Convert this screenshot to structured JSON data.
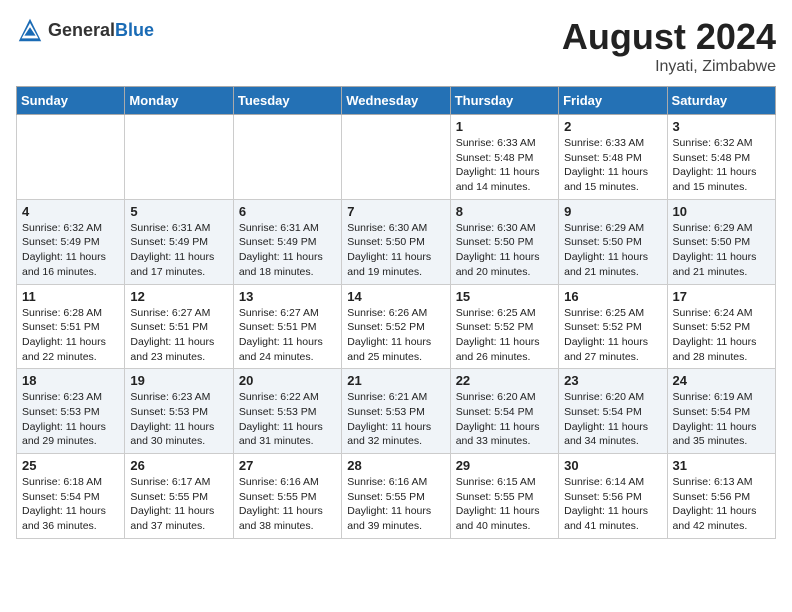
{
  "header": {
    "logo_general": "General",
    "logo_blue": "Blue",
    "month_year": "August 2024",
    "location": "Inyati, Zimbabwe"
  },
  "days_of_week": [
    "Sunday",
    "Monday",
    "Tuesday",
    "Wednesday",
    "Thursday",
    "Friday",
    "Saturday"
  ],
  "weeks": [
    [
      {
        "day": "",
        "info": ""
      },
      {
        "day": "",
        "info": ""
      },
      {
        "day": "",
        "info": ""
      },
      {
        "day": "",
        "info": ""
      },
      {
        "day": "1",
        "info": "Sunrise: 6:33 AM\nSunset: 5:48 PM\nDaylight: 11 hours\nand 14 minutes."
      },
      {
        "day": "2",
        "info": "Sunrise: 6:33 AM\nSunset: 5:48 PM\nDaylight: 11 hours\nand 15 minutes."
      },
      {
        "day": "3",
        "info": "Sunrise: 6:32 AM\nSunset: 5:48 PM\nDaylight: 11 hours\nand 15 minutes."
      }
    ],
    [
      {
        "day": "4",
        "info": "Sunrise: 6:32 AM\nSunset: 5:49 PM\nDaylight: 11 hours\nand 16 minutes."
      },
      {
        "day": "5",
        "info": "Sunrise: 6:31 AM\nSunset: 5:49 PM\nDaylight: 11 hours\nand 17 minutes."
      },
      {
        "day": "6",
        "info": "Sunrise: 6:31 AM\nSunset: 5:49 PM\nDaylight: 11 hours\nand 18 minutes."
      },
      {
        "day": "7",
        "info": "Sunrise: 6:30 AM\nSunset: 5:50 PM\nDaylight: 11 hours\nand 19 minutes."
      },
      {
        "day": "8",
        "info": "Sunrise: 6:30 AM\nSunset: 5:50 PM\nDaylight: 11 hours\nand 20 minutes."
      },
      {
        "day": "9",
        "info": "Sunrise: 6:29 AM\nSunset: 5:50 PM\nDaylight: 11 hours\nand 21 minutes."
      },
      {
        "day": "10",
        "info": "Sunrise: 6:29 AM\nSunset: 5:50 PM\nDaylight: 11 hours\nand 21 minutes."
      }
    ],
    [
      {
        "day": "11",
        "info": "Sunrise: 6:28 AM\nSunset: 5:51 PM\nDaylight: 11 hours\nand 22 minutes."
      },
      {
        "day": "12",
        "info": "Sunrise: 6:27 AM\nSunset: 5:51 PM\nDaylight: 11 hours\nand 23 minutes."
      },
      {
        "day": "13",
        "info": "Sunrise: 6:27 AM\nSunset: 5:51 PM\nDaylight: 11 hours\nand 24 minutes."
      },
      {
        "day": "14",
        "info": "Sunrise: 6:26 AM\nSunset: 5:52 PM\nDaylight: 11 hours\nand 25 minutes."
      },
      {
        "day": "15",
        "info": "Sunrise: 6:25 AM\nSunset: 5:52 PM\nDaylight: 11 hours\nand 26 minutes."
      },
      {
        "day": "16",
        "info": "Sunrise: 6:25 AM\nSunset: 5:52 PM\nDaylight: 11 hours\nand 27 minutes."
      },
      {
        "day": "17",
        "info": "Sunrise: 6:24 AM\nSunset: 5:52 PM\nDaylight: 11 hours\nand 28 minutes."
      }
    ],
    [
      {
        "day": "18",
        "info": "Sunrise: 6:23 AM\nSunset: 5:53 PM\nDaylight: 11 hours\nand 29 minutes."
      },
      {
        "day": "19",
        "info": "Sunrise: 6:23 AM\nSunset: 5:53 PM\nDaylight: 11 hours\nand 30 minutes."
      },
      {
        "day": "20",
        "info": "Sunrise: 6:22 AM\nSunset: 5:53 PM\nDaylight: 11 hours\nand 31 minutes."
      },
      {
        "day": "21",
        "info": "Sunrise: 6:21 AM\nSunset: 5:53 PM\nDaylight: 11 hours\nand 32 minutes."
      },
      {
        "day": "22",
        "info": "Sunrise: 6:20 AM\nSunset: 5:54 PM\nDaylight: 11 hours\nand 33 minutes."
      },
      {
        "day": "23",
        "info": "Sunrise: 6:20 AM\nSunset: 5:54 PM\nDaylight: 11 hours\nand 34 minutes."
      },
      {
        "day": "24",
        "info": "Sunrise: 6:19 AM\nSunset: 5:54 PM\nDaylight: 11 hours\nand 35 minutes."
      }
    ],
    [
      {
        "day": "25",
        "info": "Sunrise: 6:18 AM\nSunset: 5:54 PM\nDaylight: 11 hours\nand 36 minutes."
      },
      {
        "day": "26",
        "info": "Sunrise: 6:17 AM\nSunset: 5:55 PM\nDaylight: 11 hours\nand 37 minutes."
      },
      {
        "day": "27",
        "info": "Sunrise: 6:16 AM\nSunset: 5:55 PM\nDaylight: 11 hours\nand 38 minutes."
      },
      {
        "day": "28",
        "info": "Sunrise: 6:16 AM\nSunset: 5:55 PM\nDaylight: 11 hours\nand 39 minutes."
      },
      {
        "day": "29",
        "info": "Sunrise: 6:15 AM\nSunset: 5:55 PM\nDaylight: 11 hours\nand 40 minutes."
      },
      {
        "day": "30",
        "info": "Sunrise: 6:14 AM\nSunset: 5:56 PM\nDaylight: 11 hours\nand 41 minutes."
      },
      {
        "day": "31",
        "info": "Sunrise: 6:13 AM\nSunset: 5:56 PM\nDaylight: 11 hours\nand 42 minutes."
      }
    ]
  ]
}
